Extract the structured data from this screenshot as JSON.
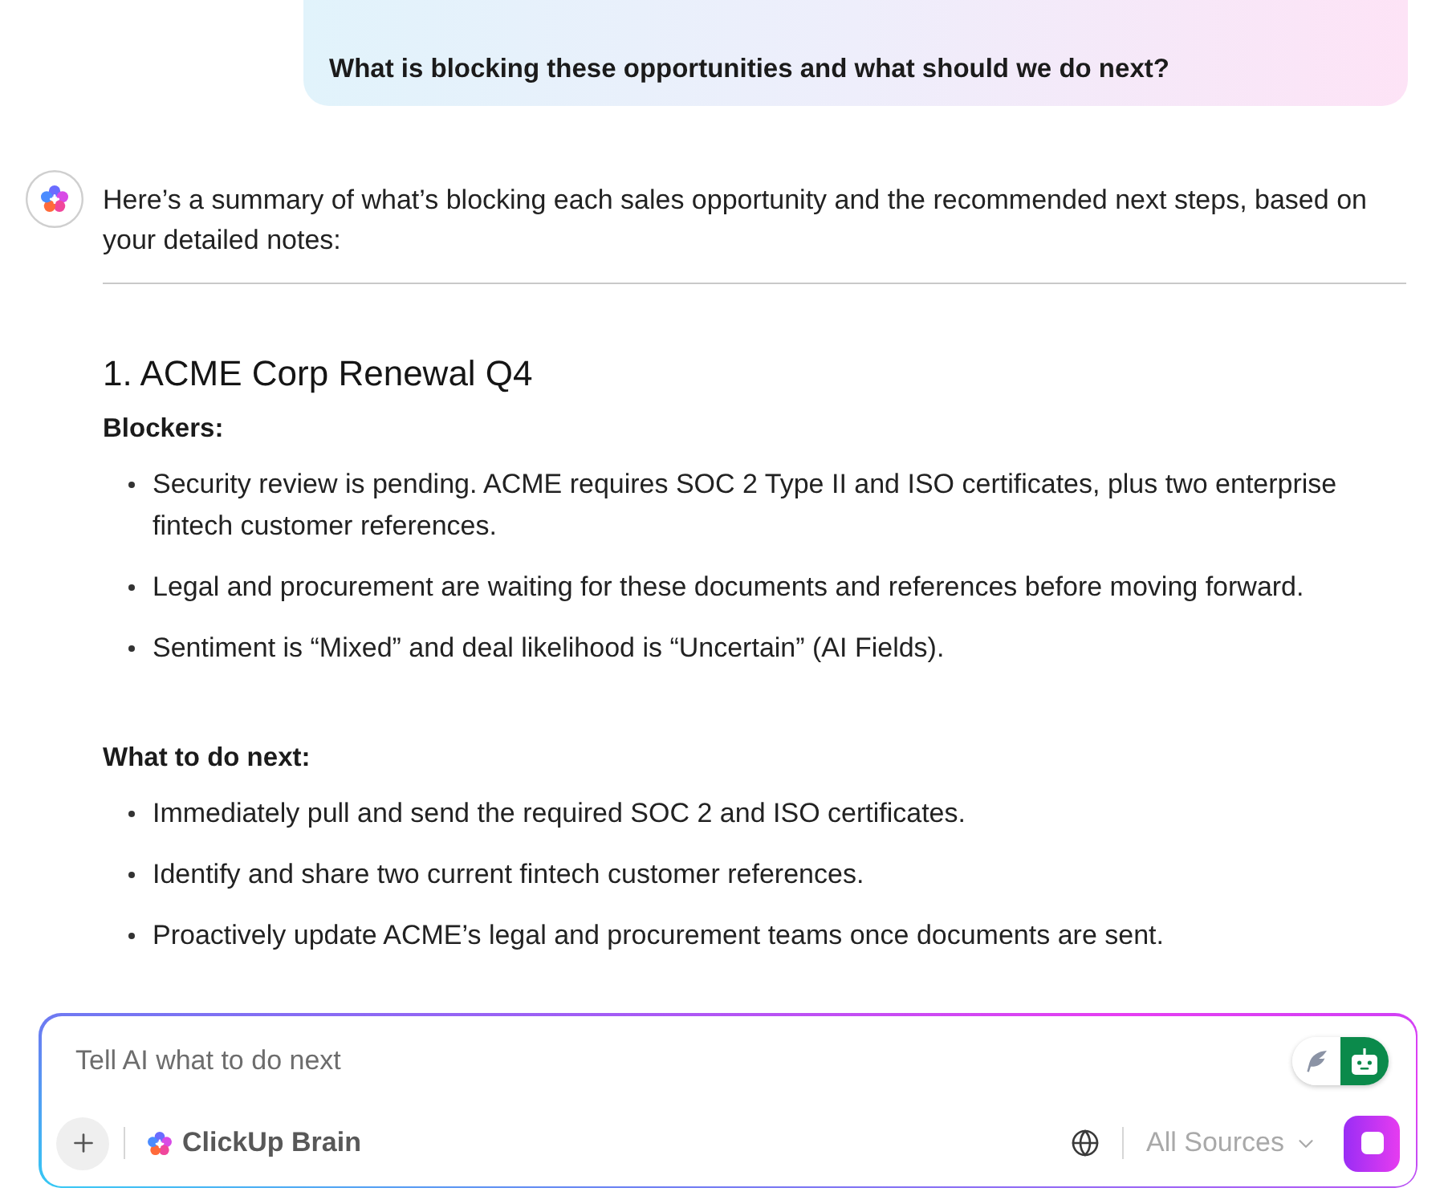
{
  "user_message": {
    "text": "What is blocking these opportunities and what should we do next?"
  },
  "assistant_message": {
    "intro": "Here’s a summary of what’s blocking each sales opportunity and the recommended next steps, based on your detailed notes:",
    "sections": [
      {
        "heading": "1. ACME Corp Renewal Q4",
        "groups": [
          {
            "label": "Blockers:",
            "items": [
              "Security review is pending. ACME requires SOC 2 Type II and ISO certificates, plus two enterprise fintech customer references.",
              "Legal and procurement are waiting for these documents and references before moving forward.",
              "Sentiment is “Mixed” and deal likelihood is “Uncertain” (AI Fields)."
            ]
          },
          {
            "label": "What to do next:",
            "items": [
              "Immediately pull and send the required SOC 2 and ISO certificates.",
              "Identify and share two current fintech customer references.",
              "Proactively update ACME’s legal and procurement teams once documents are sent."
            ]
          }
        ]
      }
    ]
  },
  "composer": {
    "placeholder": "Tell AI what to do next",
    "mode_toggle": [
      {
        "kind": "feather",
        "selected": false
      },
      {
        "kind": "robot",
        "selected": true
      }
    ],
    "assistant_name": "ClickUp Brain",
    "sources": "All Sources"
  }
}
